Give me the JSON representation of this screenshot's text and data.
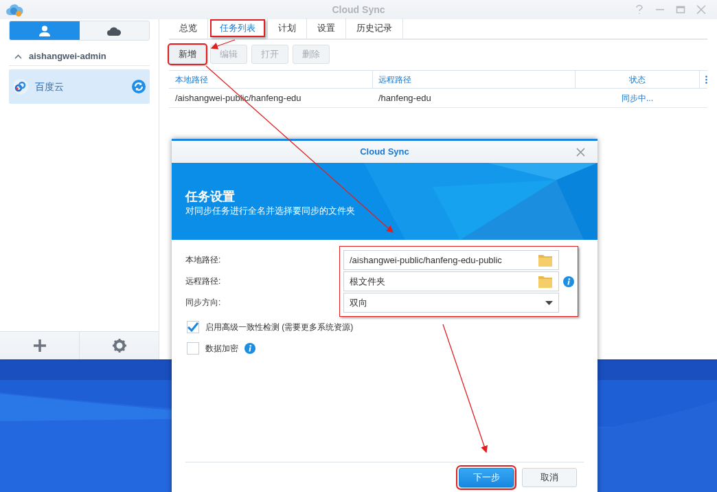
{
  "window": {
    "title": "Cloud Sync"
  },
  "sidebar": {
    "tabs": [
      {
        "selected": true
      },
      {
        "selected": false
      }
    ],
    "account": {
      "name": "aishangwei-admin",
      "expanded": true
    },
    "items": [
      {
        "label": "百度云",
        "selected": true
      }
    ]
  },
  "tabs": [
    {
      "label": "总览",
      "selected": false,
      "highlighted": false
    },
    {
      "label": "任务列表",
      "selected": true,
      "highlighted": true
    },
    {
      "label": "计划",
      "selected": false,
      "highlighted": false
    },
    {
      "label": "设置",
      "selected": false,
      "highlighted": false
    },
    {
      "label": "历史记录",
      "selected": false,
      "highlighted": false
    }
  ],
  "toolbar": [
    {
      "label": "新增",
      "disabled": false,
      "highlighted": true
    },
    {
      "label": "编辑",
      "disabled": true,
      "highlighted": false
    },
    {
      "label": "打开",
      "disabled": true,
      "highlighted": false
    },
    {
      "label": "删除",
      "disabled": true,
      "highlighted": false
    }
  ],
  "table": {
    "columns": [
      "本地路径",
      "远程路径",
      "状态"
    ],
    "rows": [
      [
        "/aishangwei-public/hanfeng-edu",
        "/hanfeng-edu",
        "同步中..."
      ]
    ]
  },
  "dialog": {
    "title": "Cloud Sync",
    "heading": "任务设置",
    "subheading": "对同步任务进行全名并选择要同步的文件夹",
    "fields_highlighted": true,
    "fields": [
      {
        "label": "本地路径:",
        "value": "/aishangwei-public/hanfeng-edu-public",
        "kind": "folder",
        "info": false
      },
      {
        "label": "远程路径:",
        "value": "根文件夹",
        "kind": "folder",
        "info": true
      },
      {
        "label": "同步方向:",
        "value": "双向",
        "kind": "select",
        "info": false
      }
    ],
    "options": [
      {
        "label": "启用高级一致性检测 (需要更多系统资源)",
        "checked": true,
        "info": false
      },
      {
        "label": "数据加密",
        "checked": false,
        "info": true
      }
    ],
    "buttons": [
      {
        "label": "下一步",
        "kind": "primary",
        "highlighted": true
      },
      {
        "label": "取消",
        "kind": "secondary",
        "highlighted": false
      }
    ]
  }
}
